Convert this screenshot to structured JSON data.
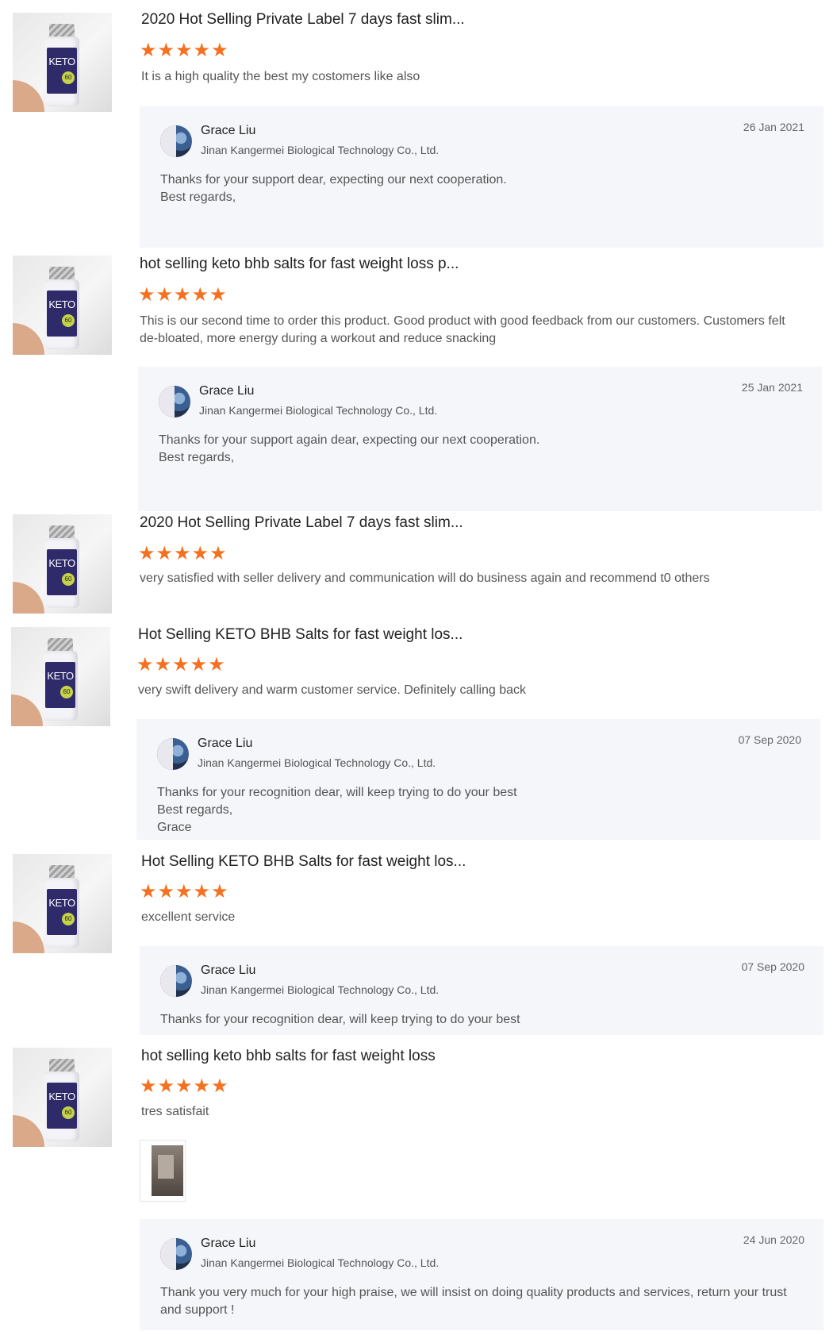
{
  "product_thumb": {
    "label": "KETO",
    "count": "60"
  },
  "reviews": [
    {
      "title": "2020 Hot Selling Private Label 7 days fast slim...",
      "rating": 5,
      "stars": "★★★★★",
      "comment": "It is a high quality the best my costomers like also",
      "reply": {
        "name": "Grace Liu",
        "company": "Jinan Kangermei Biological Technology Co., Ltd.",
        "date": "26 Jan 2021",
        "text": "Thanks for your support dear, expecting our next cooperation.\nBest regards,"
      }
    },
    {
      "title": "hot selling keto bhb salts for fast weight loss p...",
      "rating": 5,
      "stars": "★★★★★",
      "comment": "This is our second time to order this product. Good product with good feedback from our customers. Customers felt de-bloated, more energy during a workout and reduce snacking",
      "reply": {
        "name": "Grace Liu",
        "company": "Jinan Kangermei Biological Technology Co., Ltd.",
        "date": "25 Jan 2021",
        "text": "Thanks for your support again dear, expecting our next cooperation.\nBest regards,"
      }
    },
    {
      "title": "2020 Hot Selling Private Label 7 days fast slim...",
      "rating": 5,
      "stars": "★★★★★",
      "comment": "very satisfied with seller delivery and communication will do business again and recommend t0 others"
    },
    {
      "title": "Hot Selling KETO BHB Salts for fast weight los...",
      "rating": 5,
      "stars": "★★★★★",
      "comment": "very swift delivery and warm customer service. Definitely calling back",
      "reply": {
        "name": "Grace Liu",
        "company": "Jinan Kangermei Biological Technology Co., Ltd.",
        "date": "07 Sep 2020",
        "text": "Thanks for your recognition dear,  will keep trying to do your best\nBest regards,\nGrace"
      }
    },
    {
      "title": "Hot Selling KETO BHB Salts for fast weight los...",
      "rating": 5,
      "stars": "★★★★★",
      "comment": "excellent service",
      "reply": {
        "name": "Grace Liu",
        "company": "Jinan Kangermei Biological Technology Co., Ltd.",
        "date": "07 Sep 2020",
        "text": "Thanks for your recognition dear, will keep trying to do your best"
      }
    },
    {
      "title": "hot selling keto bhb salts for fast weight loss",
      "rating": 5,
      "stars": "★★★★★",
      "comment": "tres satisfait",
      "reply": {
        "name": "Grace Liu",
        "company": "Jinan Kangermei Biological Technology Co., Ltd.",
        "date": "24 Jun 2020",
        "text": "Thank you very much for your high praise, we will insist on doing quality products and services, return your trust and support !"
      }
    }
  ]
}
